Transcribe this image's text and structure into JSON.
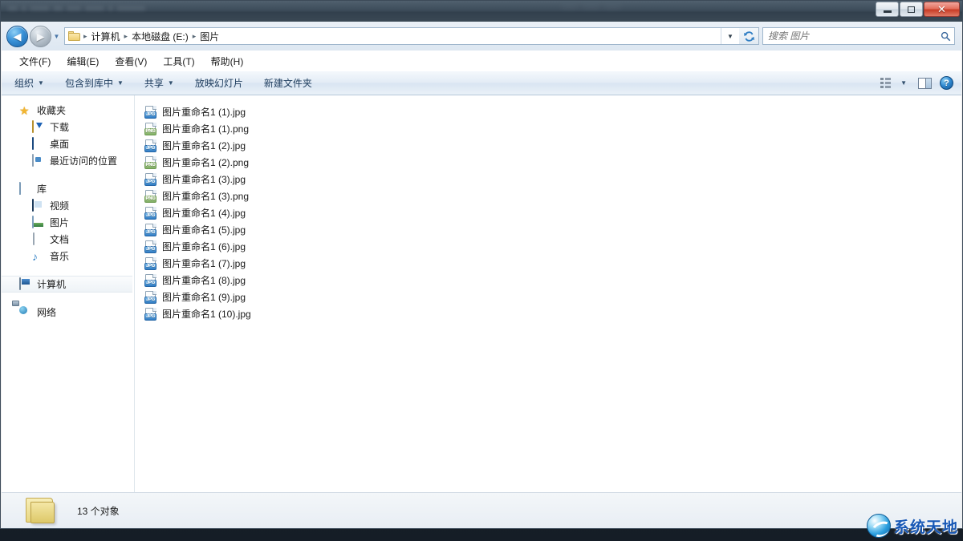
{
  "window": {
    "controls": {
      "minimize": "—",
      "maximize": "□",
      "close": "✕"
    }
  },
  "nav": {
    "back_arrow": "◀",
    "forward_arrow": "▶",
    "dropdown_caret": "▼",
    "refresh_icon": "refresh-icon",
    "breadcrumb": [
      {
        "label": "计算机"
      },
      {
        "label": "本地磁盘 (E:)"
      },
      {
        "label": "图片"
      }
    ],
    "separator": "▸"
  },
  "search": {
    "placeholder": "搜索 图片",
    "value": "",
    "icon": "search-icon"
  },
  "menubar": {
    "items": [
      {
        "label": "文件(F)"
      },
      {
        "label": "编辑(E)"
      },
      {
        "label": "查看(V)"
      },
      {
        "label": "工具(T)"
      },
      {
        "label": "帮助(H)"
      }
    ]
  },
  "toolbar": {
    "items": [
      {
        "label": "组织",
        "caret": "▼"
      },
      {
        "label": "包含到库中",
        "caret": "▼"
      },
      {
        "label": "共享",
        "caret": "▼"
      },
      {
        "label": "放映幻灯片",
        "caret": ""
      },
      {
        "label": "新建文件夹",
        "caret": ""
      }
    ],
    "view_caret": "▼",
    "help_label": "?"
  },
  "sidebar": {
    "groups": [
      {
        "header": {
          "label": "收藏夹",
          "icon": "star-icon"
        },
        "items": [
          {
            "label": "下载",
            "icon": "downloads-icon"
          },
          {
            "label": "桌面",
            "icon": "desktop-icon"
          },
          {
            "label": "最近访问的位置",
            "icon": "recent-places-icon"
          }
        ]
      },
      {
        "header": {
          "label": "库",
          "icon": "library-icon"
        },
        "items": [
          {
            "label": "视频",
            "icon": "video-icon"
          },
          {
            "label": "图片",
            "icon": "pictures-icon"
          },
          {
            "label": "文档",
            "icon": "documents-icon"
          },
          {
            "label": "音乐",
            "icon": "music-icon"
          }
        ]
      }
    ],
    "computer": {
      "label": "计算机",
      "icon": "computer-icon",
      "selected": true
    },
    "network": {
      "label": "网络",
      "icon": "network-icon"
    }
  },
  "files": [
    {
      "name": "图片重命名1 (1).jpg",
      "type": "JPG"
    },
    {
      "name": "图片重命名1 (1).png",
      "type": "PNG"
    },
    {
      "name": "图片重命名1 (2).jpg",
      "type": "JPG"
    },
    {
      "name": "图片重命名1 (2).png",
      "type": "PNG"
    },
    {
      "name": "图片重命名1 (3).jpg",
      "type": "JPG"
    },
    {
      "name": "图片重命名1 (3).png",
      "type": "PNG"
    },
    {
      "name": "图片重命名1 (4).jpg",
      "type": "JPG"
    },
    {
      "name": "图片重命名1 (5).jpg",
      "type": "JPG"
    },
    {
      "name": "图片重命名1 (6).jpg",
      "type": "JPG"
    },
    {
      "name": "图片重命名1 (7).jpg",
      "type": "JPG"
    },
    {
      "name": "图片重命名1 (8).jpg",
      "type": "JPG"
    },
    {
      "name": "图片重命名1 (9).jpg",
      "type": "JPG"
    },
    {
      "name": "图片重命名1 (10).jpg",
      "type": "JPG"
    }
  ],
  "status": {
    "text": "13 个对象",
    "folder_icon": "folder-icon"
  },
  "watermark": {
    "text": "系统天地",
    "icon": "globe-icon"
  },
  "colors": {
    "accent": "#1657b5",
    "close_button": "#c83c26",
    "jpg_badge": "#2e7bc4",
    "png_badge": "#7fae62",
    "titlebar": "#3d4c5a"
  }
}
